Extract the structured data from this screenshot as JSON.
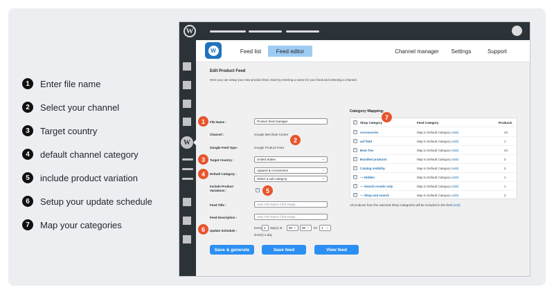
{
  "legend": [
    {
      "num": "1",
      "text": "Enter file name"
    },
    {
      "num": "2",
      "text": "Select your channel"
    },
    {
      "num": "3",
      "text": "Target country"
    },
    {
      "num": "4",
      "text": "default channel category"
    },
    {
      "num": "5",
      "text": "include product variation"
    },
    {
      "num": "6",
      "text": "Setup your update schedule"
    },
    {
      "num": "7",
      "text": "Map your categories"
    }
  ],
  "topbar": {
    "logo": "W"
  },
  "nav": {
    "tabs": [
      {
        "label": "Feed list"
      },
      {
        "label": "Feed editor"
      },
      {
        "label": "Channel manager"
      },
      {
        "label": "Settings"
      },
      {
        "label": "Support"
      }
    ]
  },
  "editor": {
    "title": "Edit Product Feed",
    "description": "Here you can setup your new product feed. Start by entering a name for your feed and selecting a channel.",
    "file_name_label": "File Name :",
    "file_name_value": "Product feed manager",
    "channel_label": "Channel :",
    "channel_value": "Google Merchant Centre",
    "feed_type_label": "Google Feed Type :",
    "feed_type_value": "Google Product Feed",
    "target_country_label": "Target Country :",
    "target_country_value": "United States",
    "default_category_label": "Default Category :",
    "default_category_value": "Apparel & Accessories",
    "sub_category_value": "Select a sub-category",
    "variations_label_1": "Include Product",
    "variations_label_2": "Variations :",
    "feed_title_label": "Feed Title :",
    "feed_title_placeholder": "uses File Name if left empty...",
    "feed_desc_label": "Feed Description :",
    "feed_desc_placeholder": "uses File Name if left empty...",
    "schedule_label": "Update Schedule :",
    "schedule_every": "Every",
    "schedule_days": "1",
    "schedule_dayat": "day(s) at",
    "schedule_hour": "00",
    "schedule_min": "00",
    "schedule_for": "for",
    "schedule_times": "1",
    "schedule_suffix": "time(s) a day"
  },
  "buttons": {
    "save_generate": "Save & generate",
    "save_feed": "Save feed",
    "view_feed": "View feed"
  },
  "mapping": {
    "title": "Category Mapping:",
    "headers": {
      "category": "Shop Category",
      "feed": "Feed Category",
      "products": "Products"
    },
    "rows": [
      {
        "category": "Accessories",
        "feed": "Map to Default Category",
        "edit": "(edit)",
        "count": "43"
      },
      {
        "category": "acf field",
        "feed": "Map to Default Category",
        "edit": "(edit)",
        "count": "1"
      },
      {
        "category": "Bow Ties",
        "feed": "Map to Default Category",
        "edit": "(edit)",
        "count": "24"
      },
      {
        "category": "Bundled products",
        "feed": "Map to Default Category",
        "edit": "(edit)",
        "count": "3"
      },
      {
        "category": "Catalog visibility",
        "feed": "Map to Default Category",
        "edit": "(edit)",
        "count": "3"
      },
      {
        "category": "— Hidden",
        "feed": "Map to Default Category",
        "edit": "(edit)",
        "count": "1"
      },
      {
        "category": "— Search results only",
        "feed": "Map to Default Category",
        "edit": "(edit)",
        "count": "1"
      },
      {
        "category": "— Shop and search",
        "feed": "Map to Default Category",
        "edit": "(edit)",
        "count": "2"
      }
    ],
    "note": "All products from the selected Shop Categories will be included in the feed",
    "note_edit": "(edit)"
  },
  "badges": [
    "1",
    "2",
    "3",
    "4",
    "5",
    "6",
    "7"
  ],
  "colors": {
    "accent": "#2c8ff2",
    "badge": "#e8542d",
    "active_tab": "#9ecbf2",
    "admin_bar": "#2c3338"
  }
}
